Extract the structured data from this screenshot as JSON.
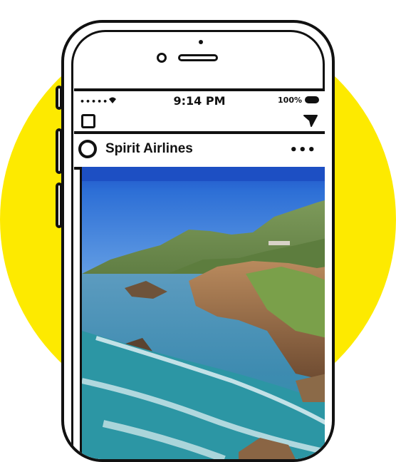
{
  "status_bar": {
    "signal": "•••••",
    "time": "9:14 PM",
    "battery": "100%"
  },
  "post": {
    "account_name": "Spirit Airlines",
    "more": "•••"
  },
  "colors": {
    "accent_disc": "#FDEA00",
    "outline": "#111111"
  },
  "icons": [
    "camera-icon",
    "send-icon",
    "avatar-ring",
    "more-options-icon",
    "wifi-icon",
    "battery-icon"
  ]
}
